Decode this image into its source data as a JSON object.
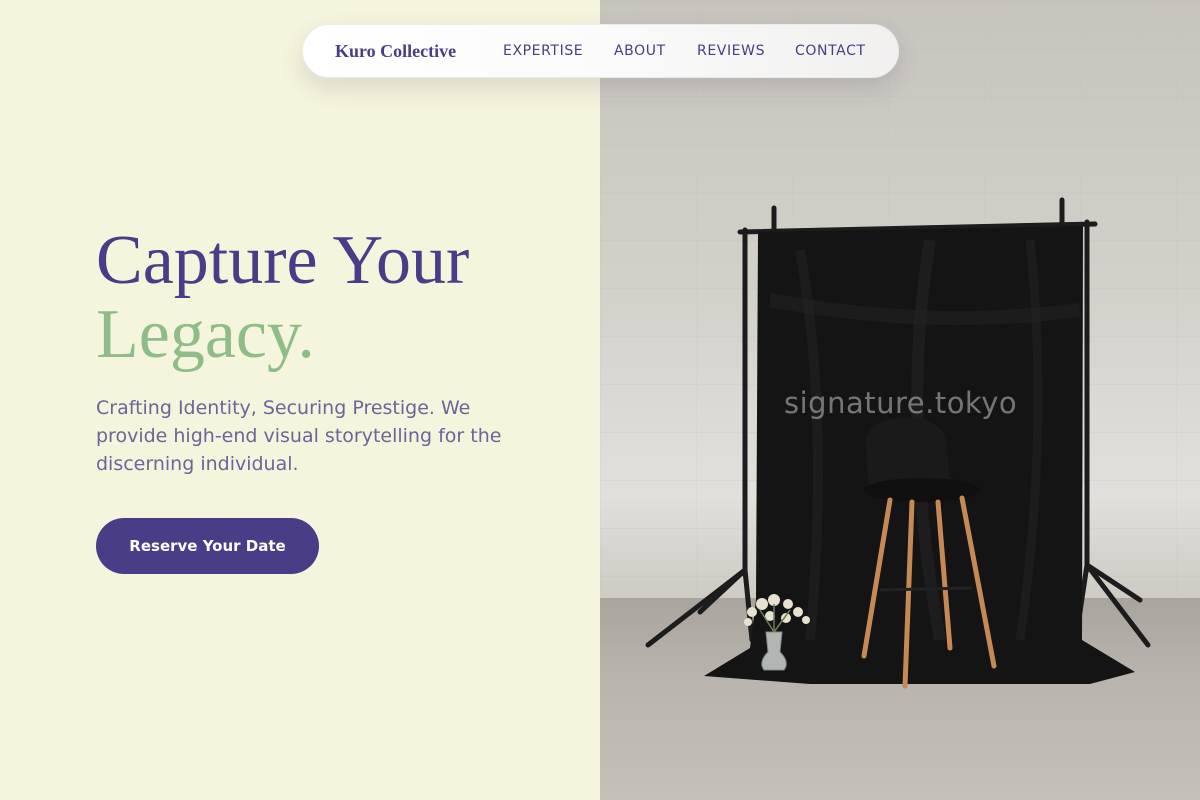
{
  "nav": {
    "brand": "Kuro Collective",
    "links": [
      "EXPERTISE",
      "ABOUT",
      "REVIEWS",
      "CONTACT"
    ]
  },
  "hero": {
    "title_line1": "Capture Your",
    "title_line2": "Legacy.",
    "subtitle": "Crafting Identity, Securing Prestige. We provide high-end visual storytelling for the discerning individual.",
    "cta_label": "Reserve Your Date"
  },
  "photo": {
    "watermark": "signature.tokyo"
  },
  "colors": {
    "left_bg": "#f5f4dc",
    "accent_purple": "#483d86",
    "accent_green": "#8fbd8a",
    "cta_bg": "#4a3d88"
  }
}
